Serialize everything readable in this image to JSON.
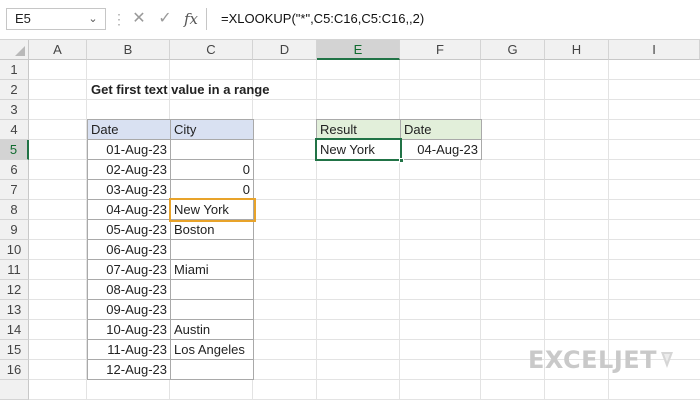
{
  "formula_bar": {
    "name_box": "E5",
    "formula": "=XLOOKUP(\"*\",C5:C16,C5:C16,,2)",
    "icons": [
      "chevron-down-icon",
      "cancel-icon",
      "check-icon",
      "fx-icon"
    ]
  },
  "columns": [
    "A",
    "B",
    "C",
    "D",
    "E",
    "F",
    "G",
    "H",
    "I"
  ],
  "rows": [
    "1",
    "2",
    "3",
    "4",
    "5",
    "6",
    "7",
    "8",
    "9",
    "10",
    "11",
    "12",
    "13",
    "14",
    "15",
    "16"
  ],
  "active_cell": "E5",
  "sheet": {
    "title": "Get first text value in a range",
    "table": {
      "headers": [
        "Date",
        "City"
      ],
      "rows": [
        {
          "date": "01-Aug-23",
          "city": ""
        },
        {
          "date": "02-Aug-23",
          "city": "0"
        },
        {
          "date": "03-Aug-23",
          "city": "0"
        },
        {
          "date": "04-Aug-23",
          "city": "New York"
        },
        {
          "date": "05-Aug-23",
          "city": "Boston"
        },
        {
          "date": "06-Aug-23",
          "city": ""
        },
        {
          "date": "07-Aug-23",
          "city": "Miami"
        },
        {
          "date": "08-Aug-23",
          "city": ""
        },
        {
          "date": "09-Aug-23",
          "city": ""
        },
        {
          "date": "10-Aug-23",
          "city": "Austin"
        },
        {
          "date": "11-Aug-23",
          "city": "Los Angeles"
        },
        {
          "date": "12-Aug-23",
          "city": ""
        }
      ]
    },
    "result": {
      "headers": [
        "Result",
        "Date"
      ],
      "result_value": "New York",
      "date_value": "04-Aug-23"
    }
  },
  "logo": {
    "text": "EXCELJET"
  },
  "colors": {
    "header_blue": "#d9e1f2",
    "header_green": "#e2efda",
    "highlight_orange": "#e8a32a",
    "selection_green": "#217346"
  }
}
